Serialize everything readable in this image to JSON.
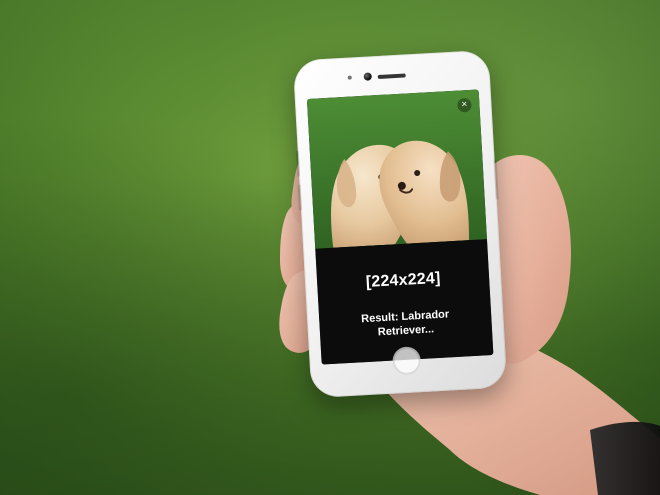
{
  "screen": {
    "overlay": {
      "size": "[224x224]",
      "result": "Result: Labrador Retriever..."
    },
    "photo": {
      "subject": "two-puppies"
    }
  },
  "icons": {
    "close": "×"
  },
  "colors": {
    "background_grass": "#4f7f2a",
    "phone_body": "#f1f1f1",
    "overlay_bg": "#0a0a0a",
    "text": "#ffffff"
  }
}
